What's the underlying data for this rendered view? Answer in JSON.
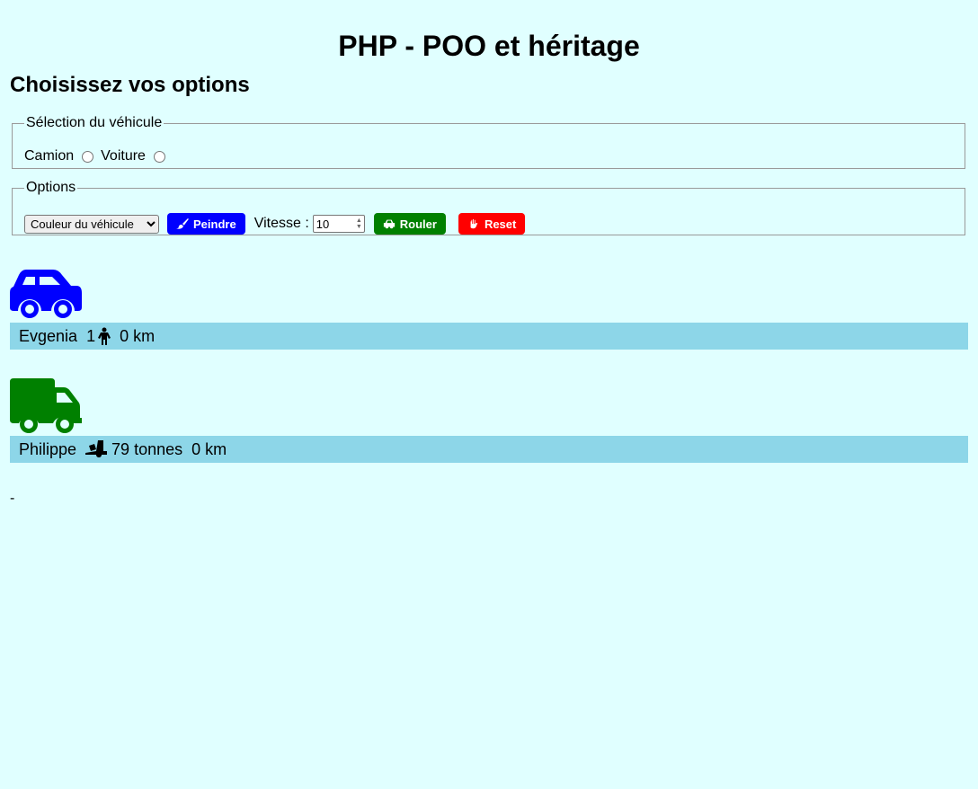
{
  "page": {
    "title": "PHP - POO et héritage",
    "subtitle": "Choisissez vos options"
  },
  "vehicle_selection": {
    "legend": "Sélection du véhicule",
    "options": [
      {
        "label": "Camion",
        "selected": false
      },
      {
        "label": "Voiture",
        "selected": false
      }
    ]
  },
  "options": {
    "legend": "Options",
    "color_select": {
      "selected": "Couleur du véhicule"
    },
    "paint_button": "Peindre",
    "speed_label": "Vitesse :",
    "speed_value": "10",
    "drive_button": "Rouler",
    "reset_button": "Reset"
  },
  "colors": {
    "background": "#e0ffff",
    "info_bar": "#8dd6e8",
    "paint": "#0000ff",
    "drive": "#008000",
    "reset": "#ff0000"
  },
  "vehicles": [
    {
      "type": "car",
      "icon": "car-icon",
      "color": "#0000ff",
      "driver": "Evgenia",
      "passengers": "1",
      "passenger_icon": "person-icon",
      "distance": "0 km"
    },
    {
      "type": "truck",
      "icon": "truck-icon",
      "color": "#008000",
      "driver": "Philippe",
      "load_icon": "truck-loading-icon",
      "load": "79 tonnes",
      "distance": "0 km"
    }
  ],
  "footer": {
    "text": "-"
  }
}
